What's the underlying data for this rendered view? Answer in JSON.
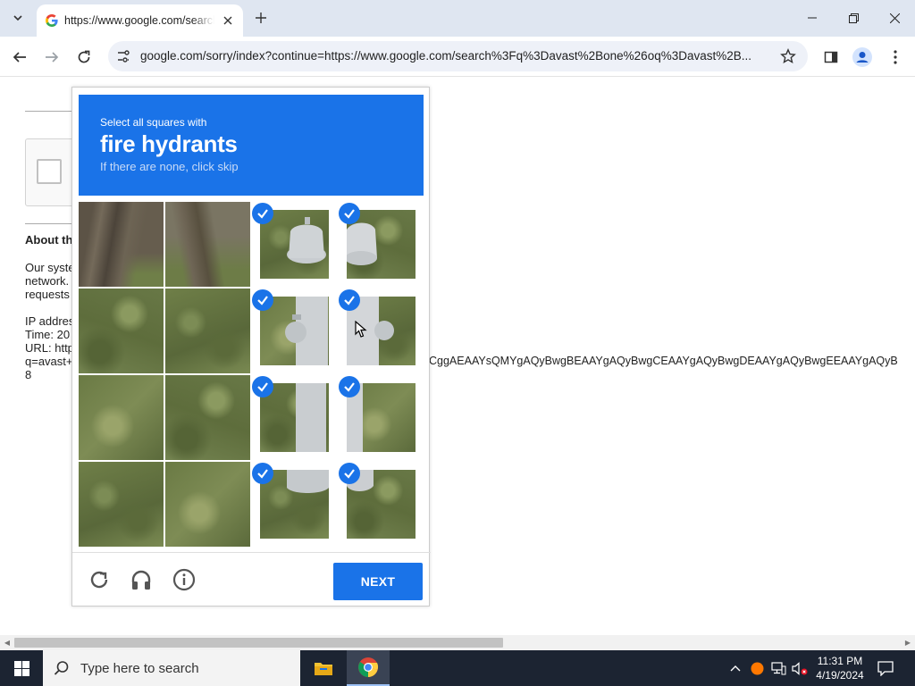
{
  "browser": {
    "tab": {
      "title": "https://www.google.com/search?q=avast+one"
    },
    "address_bar": {
      "url": "google.com/sorry/index?continue=https://www.google.com/search%3Fq%3Davast%2Bone%26oq%3Davast%2B..."
    }
  },
  "page": {
    "about_heading": "About th",
    "paragraph1": [
      "Our syste",
      "network.",
      "requests"
    ],
    "paragraph2": [
      "IP addres",
      "Time: 20",
      "URL: http",
      "q=avast+",
      "8"
    ],
    "long_line": "CggAEAAYsQMYgAQyBwgBEAAYgAQyBwgCEAAYgAQyBwgDEAAYgAQyBwgEEAAYgAQyB"
  },
  "captcha": {
    "instruction": "Select all squares with",
    "target": "fire hydrants",
    "hint": "If there are none, click skip",
    "next_label": "NEXT",
    "selected_tiles": [
      2,
      3,
      6,
      7,
      10,
      11,
      14,
      15
    ]
  },
  "taskbar": {
    "search_placeholder": "Type here to search",
    "time": "11:31 PM",
    "date": "4/19/2024"
  },
  "colors": {
    "accent": "#1a73e8",
    "taskbar": "#1c2432"
  }
}
